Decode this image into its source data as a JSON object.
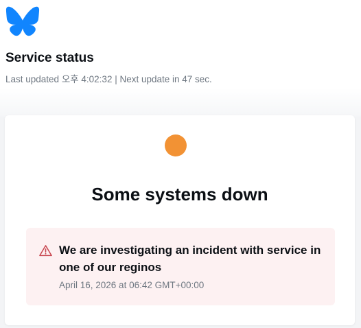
{
  "colors": {
    "brand": "#1185fe",
    "status_dot": "#f29234",
    "warning": "#c8464f",
    "incident_bg": "#fdf1f2"
  },
  "header": {
    "logo_icon": "butterfly-icon",
    "title": "Service status",
    "updated_text": "Last updated 오후 4:02:32 | Next update in 47 sec."
  },
  "status": {
    "dot_icon": "status-dot-orange",
    "title": "Some systems down"
  },
  "incident": {
    "icon": "warning-triangle-icon",
    "title": "We are investigating an incident with service in one of our reginos",
    "date": "April 16, 2026 at 06:42 GMT+00:00"
  }
}
